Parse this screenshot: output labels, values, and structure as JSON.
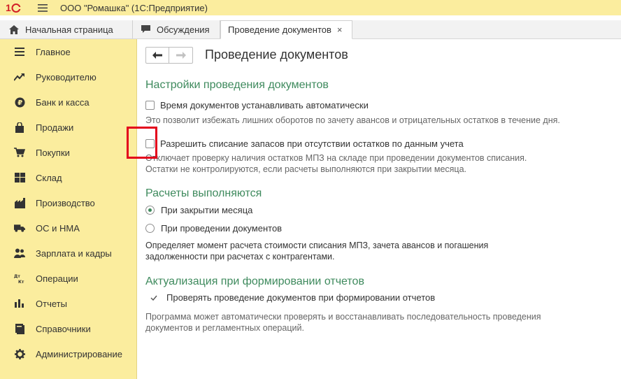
{
  "titlebar": {
    "logo": "1С",
    "title": "ООО \"Ромашка\"  (1С:Предприятие)"
  },
  "tabs": [
    {
      "label": "Начальная страница",
      "icon": "home-icon"
    },
    {
      "label": "Обсуждения",
      "icon": "chat-icon"
    },
    {
      "label": "Проведение документов",
      "close": "×"
    }
  ],
  "sidebar": {
    "items": [
      {
        "label": "Главное",
        "icon": "menu-lines-icon"
      },
      {
        "label": "Руководителю",
        "icon": "trend-icon"
      },
      {
        "label": "Банк и касса",
        "icon": "ruble-coin-icon"
      },
      {
        "label": "Продажи",
        "icon": "shopping-bag-icon"
      },
      {
        "label": "Покупки",
        "icon": "cart-icon"
      },
      {
        "label": "Склад",
        "icon": "warehouse-icon"
      },
      {
        "label": "Производство",
        "icon": "factory-icon"
      },
      {
        "label": "ОС и НМА",
        "icon": "truck-icon"
      },
      {
        "label": "Зарплата и кадры",
        "icon": "people-icon"
      },
      {
        "label": "Операции",
        "icon": "dt-kt-icon",
        "glyph": "Дт Кт"
      },
      {
        "label": "Отчеты",
        "icon": "bar-chart-icon"
      },
      {
        "label": "Справочники",
        "icon": "book-icon"
      },
      {
        "label": "Администрирование",
        "icon": "gear-icon"
      }
    ]
  },
  "main": {
    "page_title": "Проведение документов",
    "section1": {
      "heading": "Настройки проведения документов",
      "opt1_label": "Время документов устанавливать автоматически",
      "opt1_desc": "Это позволит избежать лишних оборотов по зачету авансов и отрицательных остатков в течение дня.",
      "opt2_label": "Разрешить списание запасов при отсутствии остатков по данным учета",
      "opt2_desc_line1": "Отключает проверку наличия остатков МПЗ на складе при проведении документов списания.",
      "opt2_desc_line2": "Остатки не контролируются, если расчеты выполняются при закрытии месяца."
    },
    "section2": {
      "heading": "Расчеты выполняются",
      "radio1": "При закрытии месяца",
      "radio2": "При проведении документов",
      "desc_line1": "Определяет момент расчета стоимости списания МПЗ, зачета авансов и погашения",
      "desc_line2": "задолженности при расчетах с контрагентами."
    },
    "section3": {
      "heading": "Актуализация при формировании отчетов",
      "check_label": "Проверять проведение документов при формировании отчетов",
      "desc_line1": "Программа может автоматически проверять и восстанавливать последовательность проведения",
      "desc_line2": "документов и регламентных операций."
    }
  },
  "colors": {
    "sidebar_bg": "#fbed9e",
    "accent_green": "#3e8a5d",
    "highlight_red": "#e3001b",
    "logo_red": "#d21f26"
  }
}
